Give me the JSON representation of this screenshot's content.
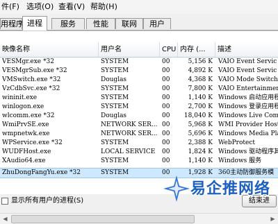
{
  "menubar": {
    "items": [
      "件(F)",
      "选项(O)",
      "查看(V)",
      "帮助(H)"
    ]
  },
  "tabs": [
    {
      "label": "用程序"
    },
    {
      "label": "进程",
      "active": true
    },
    {
      "label": "服务"
    },
    {
      "label": "性能"
    },
    {
      "label": "联网"
    },
    {
      "label": "用户"
    }
  ],
  "table": {
    "columns": [
      "映像名称",
      "用户名",
      "CPU",
      "内存 (...",
      "描述"
    ],
    "rows": [
      {
        "image": "VESMgr.exe *32",
        "user": "SYSTEM",
        "cpu": "00",
        "mem": "5,156 K",
        "desc": "VAIO Event Servic"
      },
      {
        "image": "VESMgrSub.exe *32",
        "user": "SYSTEM",
        "cpu": "00",
        "mem": "4,892 K",
        "desc": "VAIO Event Servic"
      },
      {
        "image": "VMSwitch.exe *32",
        "user": "Douglas",
        "cpu": "00",
        "mem": "4,368 K",
        "desc": "VAIO Mode Switch"
      },
      {
        "image": "VzCdbSvc.exe *32",
        "user": "SYSTEM",
        "cpu": "00",
        "mem": "7,800 K",
        "desc": "VAIO Entertainmen"
      },
      {
        "image": "wininit.exe",
        "user": "SYSTEM",
        "cpu": "00",
        "mem": "1,140 K",
        "desc": "Windows 启动应用程"
      },
      {
        "image": "winlogon.exe",
        "user": "SYSTEM",
        "cpu": "00",
        "mem": "2,700 K",
        "desc": "Windows 登录应用程"
      },
      {
        "image": "wlcomm.exe *32",
        "user": "Douglas",
        "cpu": "00",
        "mem": "18,040 K",
        "desc": "Windows Live Comm"
      },
      {
        "image": "WmiPrvSE.exe",
        "user": "NETWORK SER...",
        "cpu": "00",
        "mem": "5,968 K",
        "desc": "WMI Provider Host"
      },
      {
        "image": "wmpnetwk.exe",
        "user": "NETWORK SER...",
        "cpu": "00",
        "mem": "5,696 K",
        "desc": "Windows Media Pla"
      },
      {
        "image": "WPService.exe *32",
        "user": "SYSTEM",
        "cpu": "00",
        "mem": "2,388 K",
        "desc": "WebProtect"
      },
      {
        "image": "WUDFHost.exe",
        "user": "LOCAL SERVICE",
        "cpu": "00",
        "mem": "1,824 K",
        "desc": "Windows 驱动程序其"
      },
      {
        "image": "XAudio64.exe",
        "user": "SYSTEM",
        "cpu": "00",
        "mem": "1,140 K",
        "desc": "Windows 服务"
      },
      {
        "image": "ZhuDongFangYu.exe *32",
        "user": "SYSTEM",
        "cpu": "00",
        "mem": "1,928 K",
        "desc": "360主动防御服务模",
        "selected": true
      }
    ]
  },
  "footer": {
    "show_all_label": "显示所有用户的进程(S)",
    "show_all_checked": false,
    "end_button_label": "结束进"
  },
  "watermark": {
    "text": "易企推网络"
  },
  "colors": {
    "selection": "#cde8ff",
    "accent": "#1d61c0"
  }
}
